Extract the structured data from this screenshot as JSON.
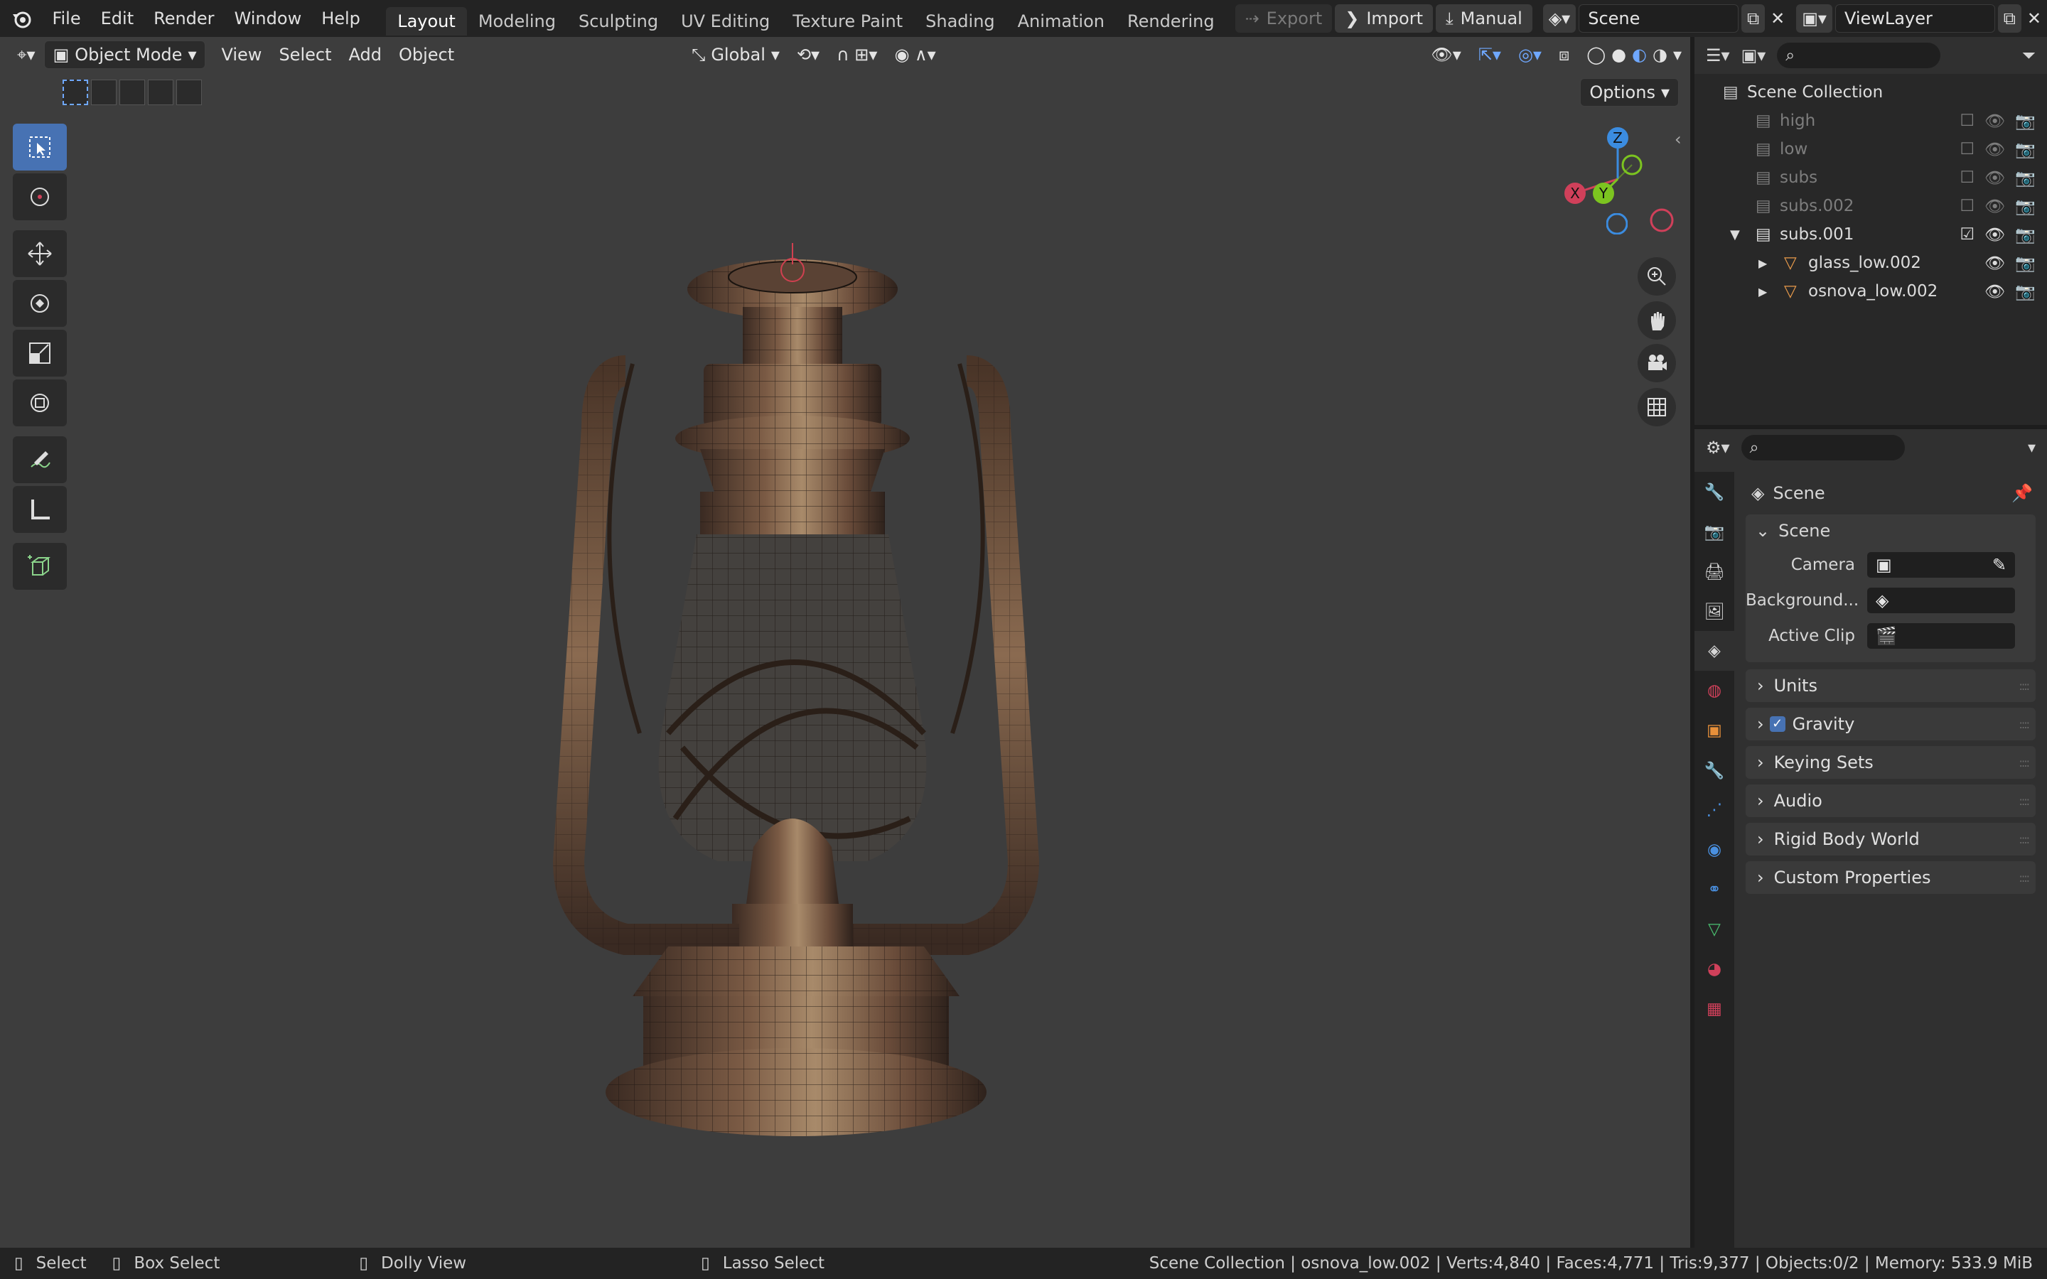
{
  "topbar": {
    "menus": [
      "File",
      "Edit",
      "Render",
      "Window",
      "Help"
    ],
    "workspaces": [
      "Layout",
      "Modeling",
      "Sculpting",
      "UV Editing",
      "Texture Paint",
      "Shading",
      "Animation",
      "Rendering"
    ],
    "active_workspace": "Layout",
    "export_label": "Export",
    "import_label": "Import",
    "manual_label": "Manual",
    "scene_name": "Scene",
    "view_layer": "ViewLayer"
  },
  "viewport": {
    "mode": "Object Mode",
    "menus": [
      "View",
      "Select",
      "Add",
      "Object"
    ],
    "orientation": "Global",
    "options_label": "Options",
    "gizmo": {
      "z": "Z",
      "x": "X",
      "y": "Y"
    }
  },
  "outliner": {
    "root": "Scene Collection",
    "items": [
      {
        "label": "high",
        "checked": false,
        "dim": true
      },
      {
        "label": "low",
        "checked": false,
        "dim": true
      },
      {
        "label": "subs",
        "checked": false,
        "dim": true
      },
      {
        "label": "subs.002",
        "checked": false,
        "dim": true
      },
      {
        "label": "subs.001",
        "checked": true,
        "dim": false
      }
    ],
    "children": [
      {
        "label": "glass_low.002"
      },
      {
        "label": "osnova_low.002"
      }
    ]
  },
  "properties": {
    "context": "Scene",
    "section": "Scene",
    "camera_label": "Camera",
    "background_label": "Background...",
    "active_clip_label": "Active Clip",
    "panels": [
      "Units",
      "Gravity",
      "Keying Sets",
      "Audio",
      "Rigid Body World",
      "Custom Properties"
    ]
  },
  "statusbar": {
    "select": "Select",
    "box_select": "Box Select",
    "dolly_view": "Dolly View",
    "lasso_select": "Lasso Select",
    "stats": "Scene Collection | osnova_low.002 | Verts:4,840 | Faces:4,771 | Tris:9,377 | Objects:0/2 | Memory: 533.9 MiB"
  },
  "colors": {
    "accent": "#4772b3",
    "axis_x": "#d0405a",
    "axis_y": "#7cc420",
    "axis_z": "#3b8ce0"
  }
}
